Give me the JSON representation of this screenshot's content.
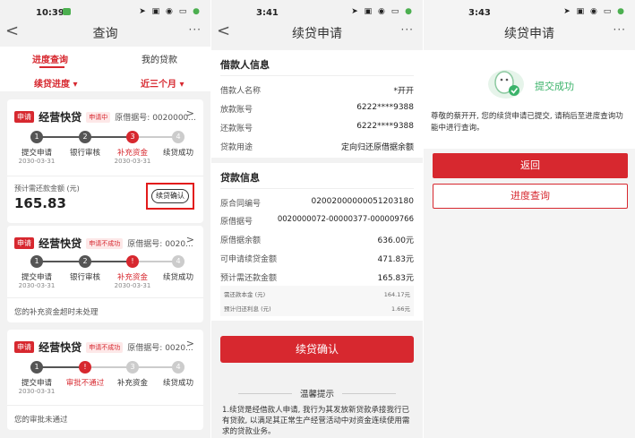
{
  "screen1": {
    "time": "10:39",
    "title": "查询",
    "back": "<",
    "more": "···",
    "tabs": {
      "progress": "进度查询",
      "loans": "我的贷款"
    },
    "filters": {
      "progress": "续贷进度 ▾",
      "period": "近三个月 ▾"
    },
    "cards": [
      {
        "tag": "申请",
        "product": "经营快贷",
        "status": "申请中",
        "orig": "原借据号: 0020000...",
        "steps": [
          {
            "num": "1",
            "label": "提交申请",
            "date": "2030-03-31",
            "state": "done"
          },
          {
            "num": "2",
            "label": "银行审核",
            "date": "",
            "state": "done"
          },
          {
            "num": "3",
            "label": "补充资金",
            "date": "2030-03-31",
            "state": "cur"
          },
          {
            "num": "4",
            "label": "续贷成功",
            "date": "",
            "state": "todo"
          }
        ],
        "amount_label": "预计需还款金额 (元)",
        "amount": "165.83",
        "confirm": "续贷确认"
      },
      {
        "tag": "申请",
        "product": "经营快贷",
        "status": "申请不成功",
        "orig": "原借据号: 0020...",
        "steps": [
          {
            "num": "1",
            "label": "提交申请",
            "date": "2030-03-31",
            "state": "done"
          },
          {
            "num": "2",
            "label": "银行审核",
            "date": "",
            "state": "done"
          },
          {
            "num": "!",
            "label": "补充资金",
            "date": "2030-03-31",
            "state": "cur"
          },
          {
            "num": "4",
            "label": "续贷成功",
            "date": "",
            "state": "todo"
          }
        ],
        "note": "您的补充资金超时未处理"
      },
      {
        "tag": "申请",
        "product": "经营快贷",
        "status": "申请不成功",
        "orig": "原借据号: 0020...",
        "steps": [
          {
            "num": "1",
            "label": "提交申请",
            "date": "2030-03-31",
            "state": "done"
          },
          {
            "num": "!",
            "label": "审批不通过",
            "date": "",
            "state": "cur"
          },
          {
            "num": "3",
            "label": "补充资金",
            "date": "",
            "state": "todo"
          },
          {
            "num": "4",
            "label": "续贷成功",
            "date": "",
            "state": "todo"
          }
        ],
        "note": "您的审批未通过"
      }
    ]
  },
  "screen2": {
    "time": "3:41",
    "title": "续贷申请",
    "back": "<",
    "more": "···",
    "borrower": {
      "title": "借款人信息",
      "rows": [
        {
          "k": "借款人名称",
          "v": "*开开"
        },
        {
          "k": "放款账号",
          "v": "6222****9388"
        },
        {
          "k": "还款账号",
          "v": "6222****9388"
        },
        {
          "k": "贷款用途",
          "v": "定向归还原借据余额"
        }
      ]
    },
    "loan": {
      "title": "贷款信息",
      "rows": [
        {
          "k": "原合同编号",
          "v": "02002000000051203180"
        },
        {
          "k": "原借据号",
          "v": "0020000072-00000377-000009766"
        },
        {
          "k": "原借据余额",
          "v": "636.00元"
        },
        {
          "k": "可申请续贷金额",
          "v": "471.83元"
        },
        {
          "k": "预计需还款金额",
          "v": "165.83元"
        }
      ],
      "subrows": [
        {
          "k": "需还款本金 (元)",
          "v": "164.17元"
        },
        {
          "k": "预计归还利息 (元)",
          "v": "1.66元"
        }
      ]
    },
    "confirm": "续贷确认",
    "tips_title": "温馨提示",
    "tips_text": "1.续贷是经借款人申请, 我行为其发放新贷款承接我行已有贷款, 以满足其正常生产经营活动中对资金连续使用需求的贷款业务。"
  },
  "screen3": {
    "time": "3:43",
    "title": "续贷申请",
    "more": "···",
    "success": "提交成功",
    "message": "尊敬的蔡开开, 您的续贷申请已提交, 请稍后至进度查询功能中进行查询。",
    "back_btn": "返回",
    "query_btn": "进度查询"
  },
  "colors": {
    "accent": "#d7282f",
    "bg": "#f2f2f2"
  }
}
